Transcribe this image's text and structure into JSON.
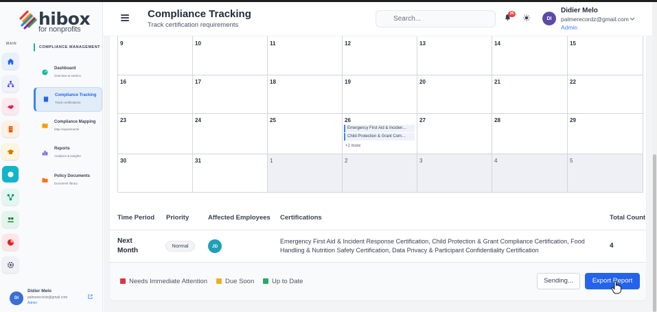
{
  "brand": {
    "name": "hibox",
    "tagline": "for nonprofits"
  },
  "rail": {
    "label": "MAIN",
    "buttons": [
      {
        "icon": "home-icon",
        "color": "#e7f0fb"
      },
      {
        "icon": "org-chart-icon",
        "color": "#eef2fb"
      },
      {
        "icon": "handshake-icon",
        "color": "#fde8ee"
      },
      {
        "icon": "building-icon",
        "color": "#fdf1e2"
      },
      {
        "icon": "graduation-cap-icon",
        "color": "#fdf6dc"
      },
      {
        "icon": "compliance-icon",
        "color": "#0fb5c8"
      },
      {
        "icon": "workflow-icon",
        "color": "#e2f7ef"
      },
      {
        "icon": "people-icon",
        "color": "#e3f5ea"
      },
      {
        "icon": "pie-chart-icon",
        "color": "#fde6e6"
      },
      {
        "icon": "settings-icon",
        "color": "#eef1f5"
      }
    ]
  },
  "sidebar": {
    "section_title": "COMPLIANCE MANAGEMENT",
    "items": [
      {
        "title": "Dashboard",
        "sub": "Overview & metrics"
      },
      {
        "title": "Compliance Tracking",
        "sub": "Track certifications"
      },
      {
        "title": "Compliance Mapping",
        "sub": "Map requirements"
      },
      {
        "title": "Reports",
        "sub": "Analytics & insights"
      },
      {
        "title": "Policy Documents",
        "sub": "Document library"
      }
    ],
    "user": {
      "initials": "DI",
      "name": "Didier Melo",
      "email": "palmerecordz@gmail.com",
      "role": "Admin"
    }
  },
  "header": {
    "title": "Compliance Tracking",
    "subtitle": "Track certification requirements",
    "search_placeholder": "Search...",
    "notification_count": "36",
    "user": {
      "initials": "DI",
      "name": "Didier Melo",
      "email": "palmerecordz@gmail.com",
      "role": "Admin"
    }
  },
  "calendar": {
    "rows": [
      [
        {
          "d": "9"
        },
        {
          "d": "10"
        },
        {
          "d": "11"
        },
        {
          "d": "12"
        },
        {
          "d": "13"
        },
        {
          "d": "14"
        },
        {
          "d": "15"
        }
      ],
      [
        {
          "d": "16"
        },
        {
          "d": "17"
        },
        {
          "d": "18"
        },
        {
          "d": "19"
        },
        {
          "d": "20"
        },
        {
          "d": "21"
        },
        {
          "d": "22"
        }
      ],
      [
        {
          "d": "23"
        },
        {
          "d": "24"
        },
        {
          "d": "25"
        },
        {
          "d": "26"
        },
        {
          "d": "27"
        },
        {
          "d": "28"
        },
        {
          "d": "29"
        }
      ],
      [
        {
          "d": "30"
        },
        {
          "d": "31"
        },
        {
          "d": "1"
        },
        {
          "d": "2"
        },
        {
          "d": "3"
        },
        {
          "d": "4"
        },
        {
          "d": "5"
        }
      ]
    ],
    "events_26": [
      "Emergency First Aid & Inciden…",
      "Child Protection & Grant Com…"
    ],
    "more_26": "+2 more"
  },
  "table": {
    "headers": {
      "period": "Time Period",
      "priority": "Priority",
      "employees": "Affected Employees",
      "certs": "Certifications",
      "count": "Total Count"
    },
    "row": {
      "period": "Next Month",
      "priority": "Normal",
      "employee_initials": "JD",
      "certifications": "Emergency First Aid & Incident Response Certification, Child Protection & Grant Compliance Certification, Food Handling & Nutrition Safety Certification, Data Privacy & Participant Confidentiality Certification",
      "count": "4"
    }
  },
  "legend": {
    "items": [
      {
        "label": "Needs Immediate Attention",
        "color": "#dc3545"
      },
      {
        "label": "Due Soon",
        "color": "#f0ad24"
      },
      {
        "label": "Up to Date",
        "color": "#28a96b"
      }
    ],
    "sending_label": "Sending...",
    "export_label": "Export Report"
  }
}
